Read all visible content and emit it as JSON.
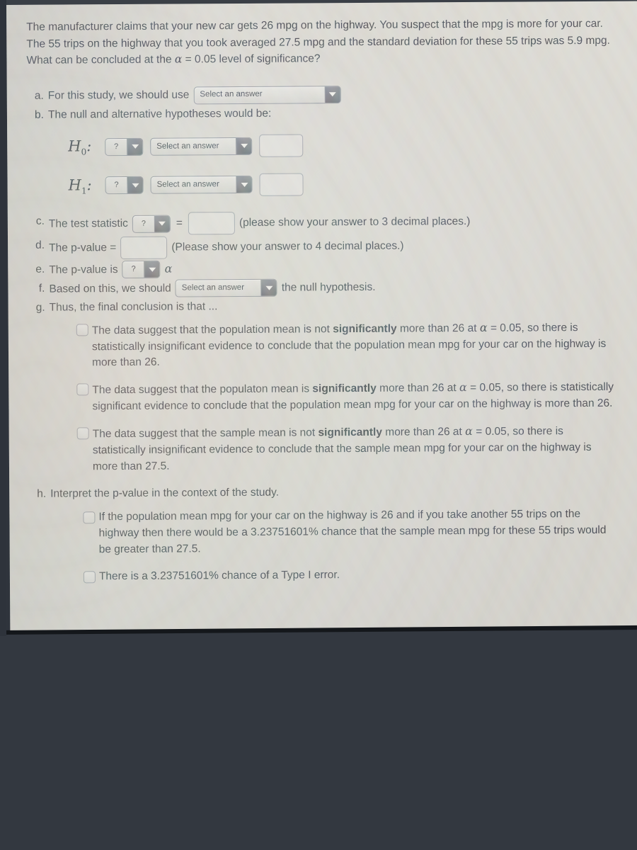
{
  "intro": {
    "text_part1": "The manufacturer claims that your new car gets 26 mpg on the highway. You suspect that the mpg is more for your car. The 55 trips on the highway that you took averaged 27.5 mpg and the standard deviation for these 55 trips was 5.9 mpg. What can be concluded at the ",
    "alpha_symbol": "α",
    "text_part2": " = 0.05 level of significance?"
  },
  "widgets": {
    "select_placeholder": "Select an answer",
    "question_mark": "?",
    "dropdown_arrow_icon": "chevron-down-icon"
  },
  "parts": {
    "a": {
      "marker": "a.",
      "text_before": "For this study, we should use",
      "select_value": "Select an answer"
    },
    "b": {
      "marker": "b.",
      "text": "The null and alternative hypotheses would be:",
      "h0_label": "H",
      "h0_sub": "0",
      "h0_colon": ":",
      "h1_label": "H",
      "h1_sub": "1",
      "h1_colon": ":",
      "h0_param_value": "?",
      "h0_compare_value": "Select an answer",
      "h0_textbox_value": "",
      "h1_param_value": "?",
      "h1_compare_value": "Select an answer",
      "h1_textbox_value": ""
    },
    "c": {
      "marker": "c.",
      "text_before": "The test statistic",
      "stat_select_value": "?",
      "equals": "=",
      "textbox_value": "",
      "text_after": "(please show your answer to 3 decimal places.)"
    },
    "d": {
      "marker": "d.",
      "text_before": "The p-value =",
      "textbox_value": "",
      "text_after": "(Please show your answer to 4 decimal places.)"
    },
    "e": {
      "marker": "e.",
      "text_before": "The p-value is",
      "compare_select_value": "?",
      "alpha_symbol": "α"
    },
    "f": {
      "marker": "f.",
      "text_before": "Based on this, we should",
      "select_value": "Select an answer",
      "text_after": "the null hypothesis."
    },
    "g": {
      "marker": "g.",
      "text": "Thus, the final conclusion is that ...",
      "options": [
        {
          "checked": false,
          "seg1": "The data suggest that the population mean is not ",
          "bold": "significantly",
          "seg2": " more than 26 at ",
          "alpha": "α",
          "seg3": " = 0.05, so there is statistically insignificant evidence to conclude that the population mean mpg for your car on the highway is more than 26."
        },
        {
          "checked": false,
          "seg1": "The data suggest that the populaton mean is ",
          "bold": "significantly",
          "seg2": " more than 26 at ",
          "alpha": "α",
          "seg3": " = 0.05, so there is statistically significant evidence to conclude that the population mean mpg for your car on the highway is more than 26."
        },
        {
          "checked": false,
          "seg1": "The data suggest that the sample mean is not ",
          "bold": "significantly",
          "seg2": " more than 26 at ",
          "alpha": "α",
          "seg3": " = 0.05, so there is statistically insignificant evidence to conclude that the sample mean mpg for your car on the highway is more than 27.5."
        }
      ]
    },
    "h": {
      "marker": "h.",
      "text": "Interpret the p-value in the context of the study.",
      "options": [
        {
          "checked": false,
          "text": "If the population mean mpg for your car on the highway is 26 and if you take another 55 trips on the highway then there would be a 3.23751601% chance that the sample mean mpg for these 55 trips would be greater than 27.5."
        },
        {
          "checked": false,
          "text": "There is a 3.23751601% chance of a Type I error."
        }
      ]
    }
  },
  "colors": {
    "page_background": "#d7d5cd",
    "text": "#3b4047",
    "bezel": "#2f343c",
    "widget_arrow": "#62666c"
  }
}
